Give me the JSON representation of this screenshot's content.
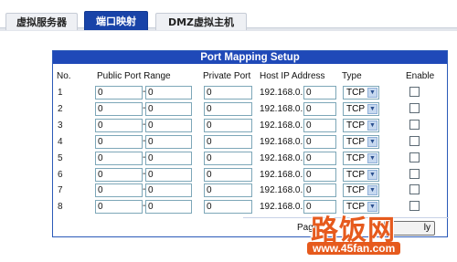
{
  "tabs": [
    {
      "label": "虚拟服务器"
    },
    {
      "label": "端口映射"
    },
    {
      "label": "DMZ虚拟主机"
    }
  ],
  "panel": {
    "title": "Port Mapping Setup",
    "columns": {
      "no": "No.",
      "public_port_range": "Public Port Range",
      "private_port": "Private Port",
      "host_ip": "Host IP Address",
      "type": "Type",
      "enable": "Enable"
    },
    "rows": [
      {
        "no": "1",
        "start": "0",
        "end": "0",
        "private": "0",
        "ip_prefix": "192.168.0.",
        "ip_last": "0",
        "type": "TCP",
        "enabled": false
      },
      {
        "no": "2",
        "start": "0",
        "end": "0",
        "private": "0",
        "ip_prefix": "192.168.0.",
        "ip_last": "0",
        "type": "TCP",
        "enabled": false
      },
      {
        "no": "3",
        "start": "0",
        "end": "0",
        "private": "0",
        "ip_prefix": "192.168.0.",
        "ip_last": "0",
        "type": "TCP",
        "enabled": false
      },
      {
        "no": "4",
        "start": "0",
        "end": "0",
        "private": "0",
        "ip_prefix": "192.168.0.",
        "ip_last": "0",
        "type": "TCP",
        "enabled": false
      },
      {
        "no": "5",
        "start": "0",
        "end": "0",
        "private": "0",
        "ip_prefix": "192.168.0.",
        "ip_last": "0",
        "type": "TCP",
        "enabled": false
      },
      {
        "no": "6",
        "start": "0",
        "end": "0",
        "private": "0",
        "ip_prefix": "192.168.0.",
        "ip_last": "0",
        "type": "TCP",
        "enabled": false
      },
      {
        "no": "7",
        "start": "0",
        "end": "0",
        "private": "0",
        "ip_prefix": "192.168.0.",
        "ip_last": "0",
        "type": "TCP",
        "enabled": false
      },
      {
        "no": "8",
        "start": "0",
        "end": "0",
        "private": "0",
        "ip_prefix": "192.168.0.",
        "ip_last": "0",
        "type": "TCP",
        "enabled": false
      }
    ],
    "page_label": "Page",
    "apply_label": "ly"
  },
  "watermark": {
    "brand": "路饭网",
    "url": "www.45fan.com"
  },
  "icons": {
    "dropdown": "chevron-down-icon"
  }
}
